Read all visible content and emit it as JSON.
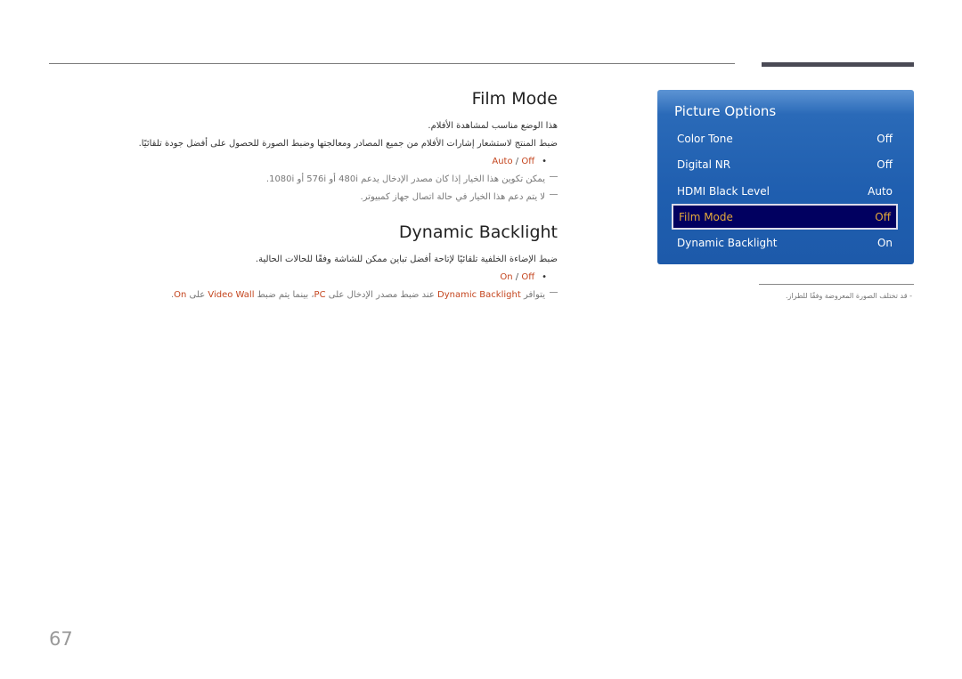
{
  "page_number": "67",
  "film_mode": {
    "title": "Film Mode",
    "para1": "هذا الوضع مناسب لمشاهدة الأفلام.",
    "para2": "ضبط المنتج لاستشعار إشارات الأفلام من جميع المصادر ومعالجتها وضبط الصورة للحصول على أفضل جودة تلقائيًا.",
    "options": {
      "a": "Auto",
      "sep": " / ",
      "b": "Off"
    },
    "note1": "يمكن تكوين هذا الخيار إذا كان مصدر الإدخال يدعم 480i أو 576i أو 1080i.",
    "note2": "لا يتم دعم هذا الخيار في حالة اتصال جهاز كمبيوتر."
  },
  "dynamic_backlight": {
    "title": "Dynamic Backlight",
    "para1": "ضبط الإضاءة الخلفية تلقائيًا لإتاحة أفضل تباين ممكن للشاشة وفقًا للحالات الحالية.",
    "options": {
      "a": "On",
      "sep": " / ",
      "b": "Off"
    },
    "note": {
      "t1": "يتوافر ",
      "h1": "Dynamic Backlight",
      "t2": " عند ضبط مصدر الإدخال على ",
      "h2": "PC",
      "t3": "، بينما يتم ضبط ",
      "h3": "Video Wall",
      "t4": " على ",
      "h4": "On",
      "t5": "."
    }
  },
  "osd_menu": {
    "title": "Picture Options",
    "items": [
      {
        "label": "Color Tone",
        "value": "Off"
      },
      {
        "label": "Digital NR",
        "value": "Off"
      },
      {
        "label": "HDMI Black Level",
        "value": "Auto"
      },
      {
        "label": "Film Mode",
        "value": "Off",
        "selected": true
      },
      {
        "label": "Dynamic Backlight",
        "value": "On"
      }
    ]
  },
  "footnote": "-  قد تختلف الصورة المعروضة وفقًا للطراز."
}
